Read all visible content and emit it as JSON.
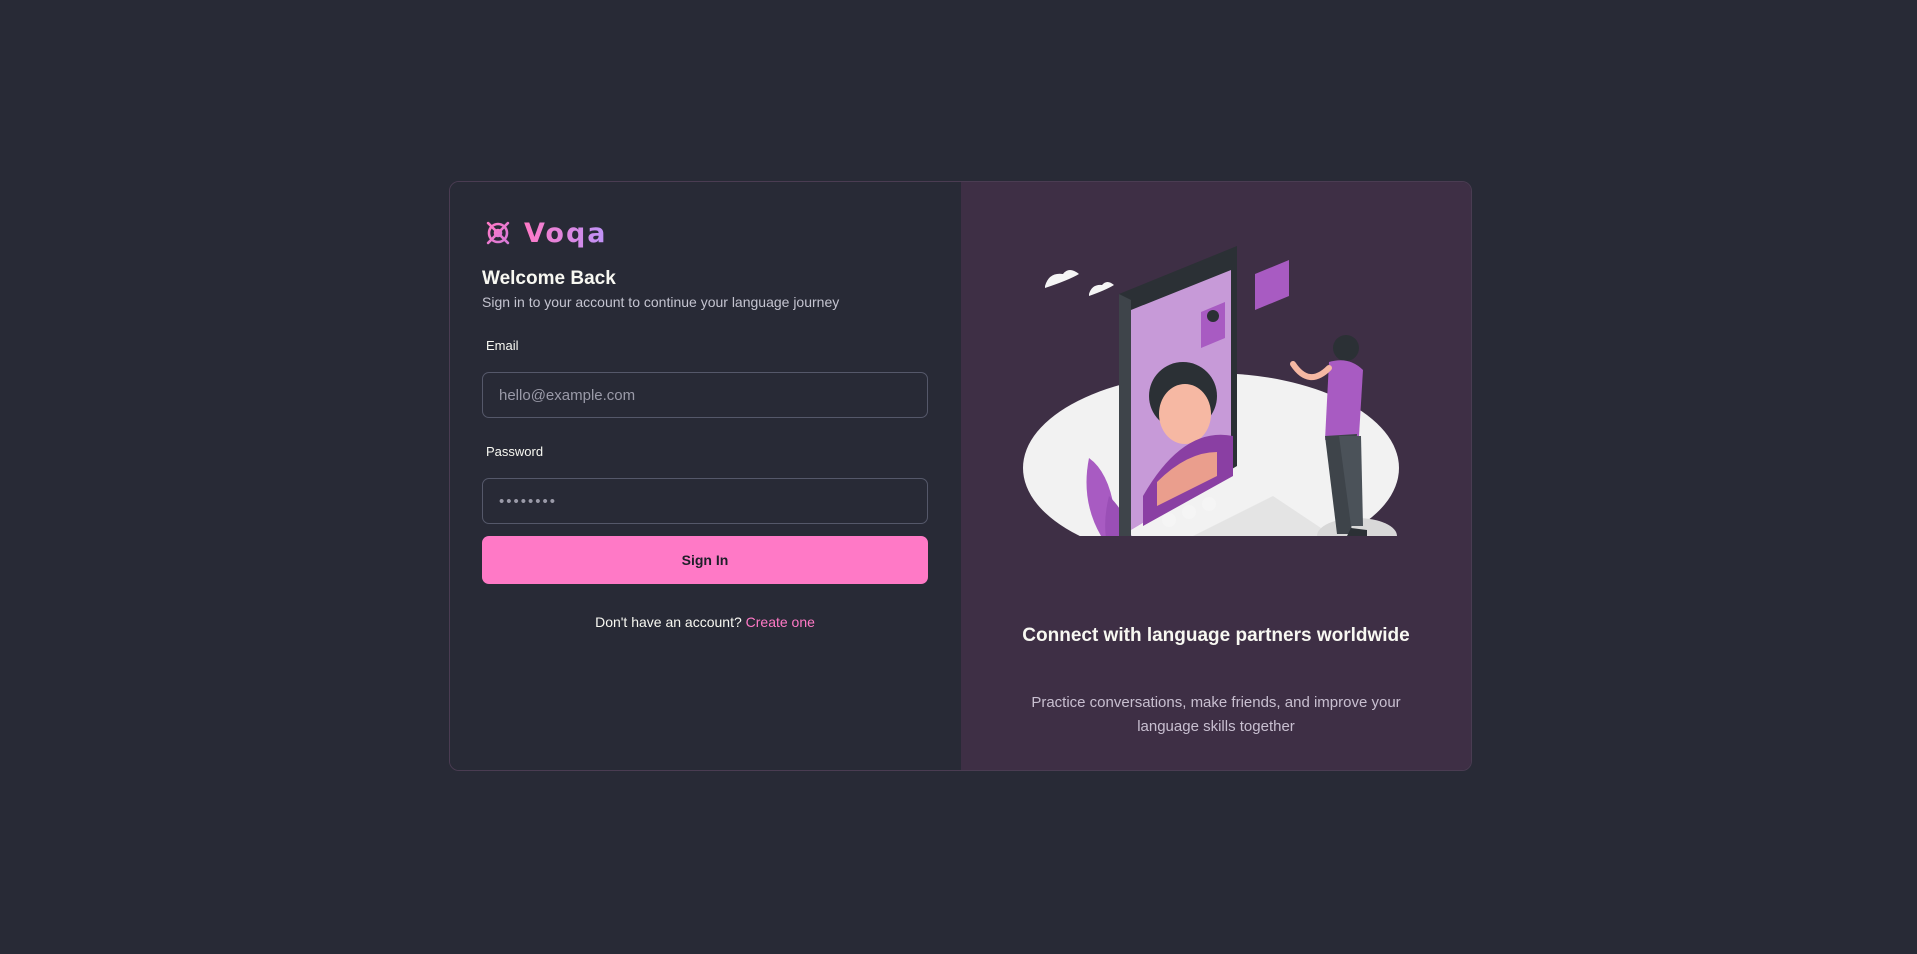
{
  "brand": {
    "name": "Voqa",
    "icon": "ship-wheel-icon",
    "color": "#ff79c6"
  },
  "login": {
    "title": "Welcome Back",
    "subtitle": "Sign in to your account to continue your language journey",
    "email_label": "Email",
    "email_placeholder": "hello@example.com",
    "password_label": "Password",
    "password_value": "••••••••",
    "submit_label": "Sign In",
    "signup_prompt": "Don't have an account?",
    "signup_link": "Create one"
  },
  "promo": {
    "title": "Connect with language partners worldwide",
    "subtitle": "Practice conversations, make friends, and improve your language skills together"
  },
  "colors": {
    "background": "#282a36",
    "panel": "#3e2f45",
    "accent": "#ff79c6",
    "illustration_accent": "#a85bc2"
  }
}
